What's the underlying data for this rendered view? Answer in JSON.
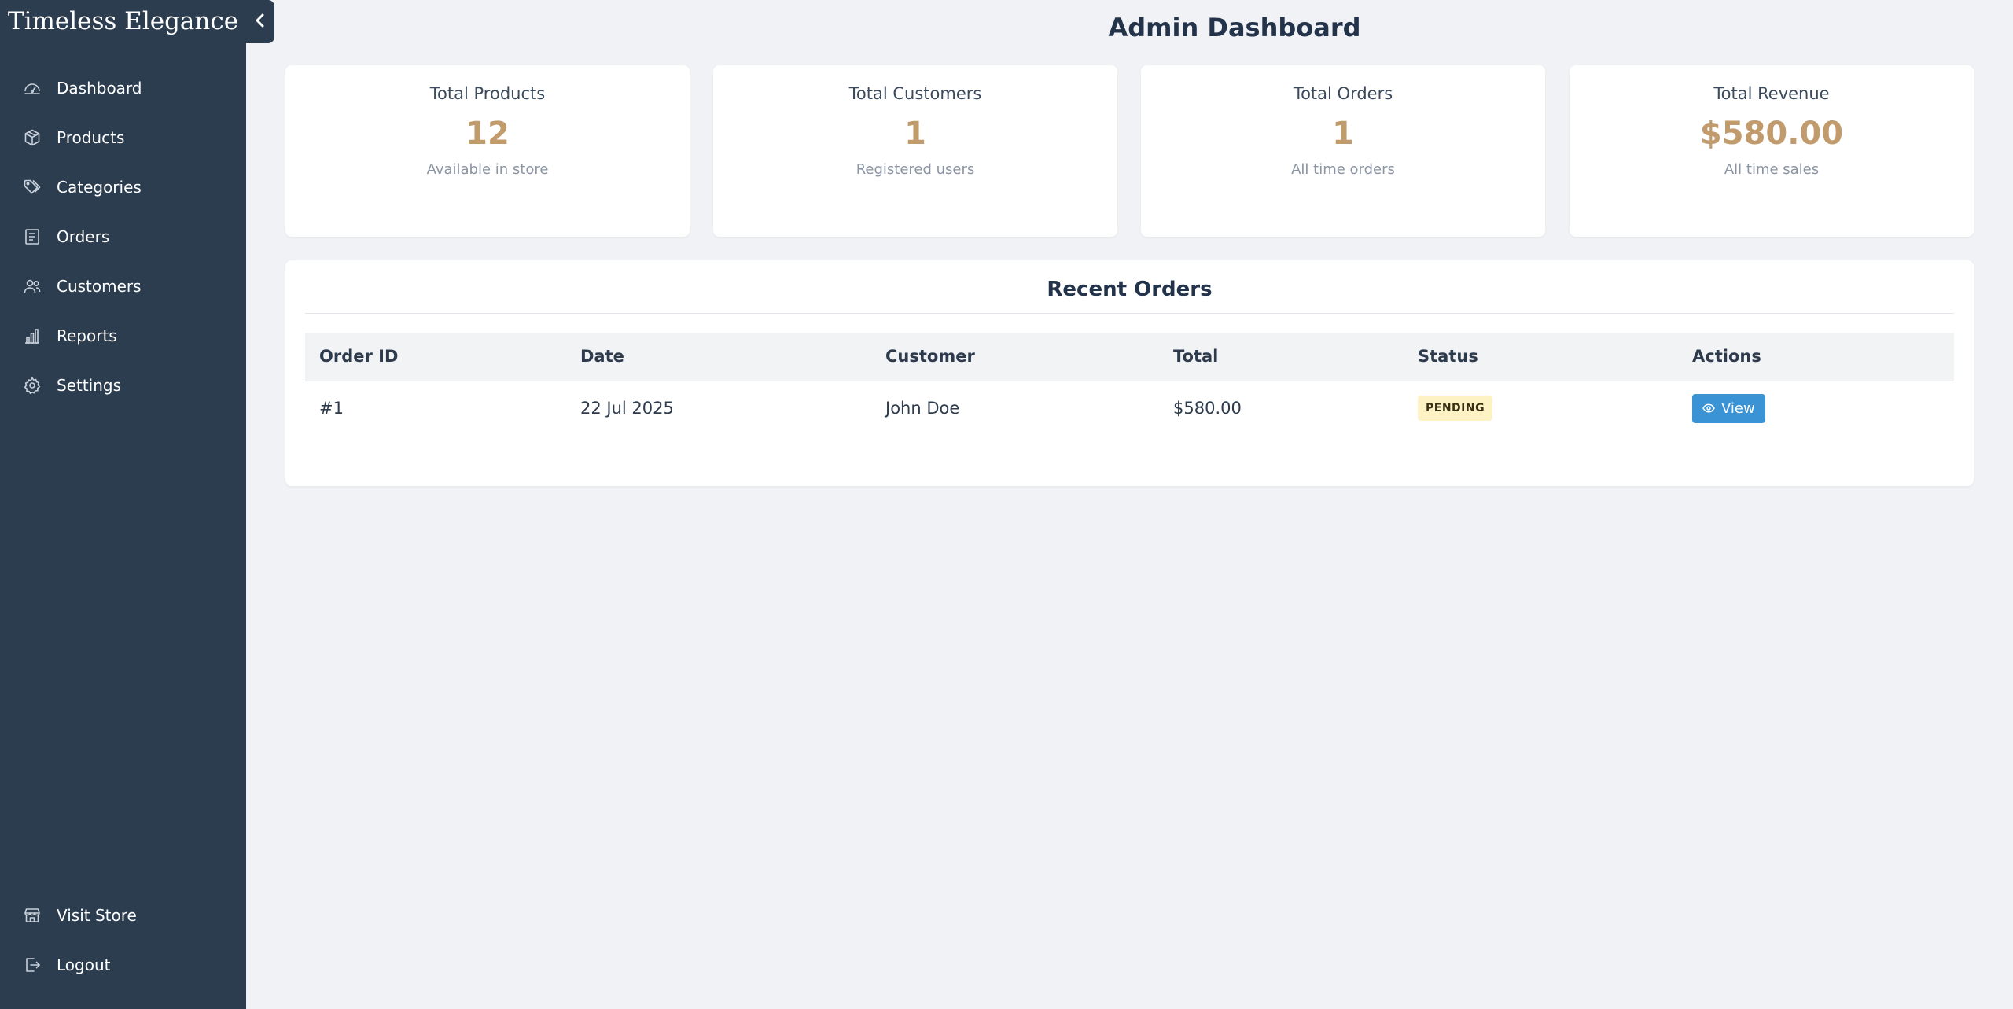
{
  "brand": "Timeless Elegance",
  "sidebar": {
    "items": [
      {
        "label": "Dashboard",
        "icon": "dashboard-icon"
      },
      {
        "label": "Products",
        "icon": "box-icon"
      },
      {
        "label": "Categories",
        "icon": "tags-icon"
      },
      {
        "label": "Orders",
        "icon": "orders-icon"
      },
      {
        "label": "Customers",
        "icon": "users-icon"
      },
      {
        "label": "Reports",
        "icon": "bar-chart-icon"
      },
      {
        "label": "Settings",
        "icon": "gear-icon"
      }
    ],
    "bottom": [
      {
        "label": "Visit Store",
        "icon": "store-icon"
      },
      {
        "label": "Logout",
        "icon": "logout-icon"
      }
    ]
  },
  "page": {
    "title": "Admin Dashboard"
  },
  "stats": [
    {
      "title": "Total Products",
      "value": "12",
      "sub": "Available in store"
    },
    {
      "title": "Total Customers",
      "value": "1",
      "sub": "Registered users"
    },
    {
      "title": "Total Orders",
      "value": "1",
      "sub": "All time orders"
    },
    {
      "title": "Total Revenue",
      "value": "$580.00",
      "sub": "All time sales"
    }
  ],
  "orders": {
    "title": "Recent Orders",
    "columns": [
      "Order ID",
      "Date",
      "Customer",
      "Total",
      "Status",
      "Actions"
    ],
    "rows": [
      {
        "id": "#1",
        "date": "22 Jul 2025",
        "customer": "John Doe",
        "total": "$580.00",
        "status": "PENDING",
        "action": "View"
      }
    ]
  },
  "colors": {
    "sidebar": "#2d3d50",
    "accent": "#c29b6c",
    "button": "#3a93d4",
    "badge_bg": "#fdf2c4"
  }
}
